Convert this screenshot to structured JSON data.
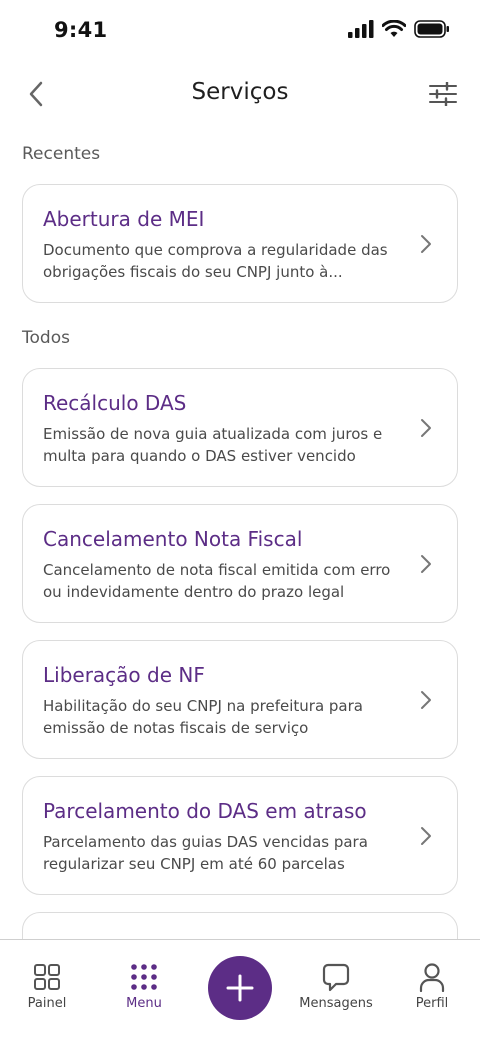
{
  "status_bar": {
    "time": "9:41"
  },
  "header": {
    "title": "Serviços"
  },
  "sections": {
    "recent": "Recentes",
    "all": "Todos"
  },
  "recent_cards": [
    {
      "title": "Abertura de MEI",
      "description": "Documento que comprova a regularidade das obrigações fiscais do seu CNPJ junto à..."
    }
  ],
  "all_cards": [
    {
      "title": "Recálculo DAS",
      "description": "Emissão de nova guia atualizada com juros e multa para quando o DAS estiver vencido"
    },
    {
      "title": "Cancelamento Nota Fiscal",
      "description": "Cancelamento de nota fiscal emitida com erro ou indevidamente dentro do prazo legal"
    },
    {
      "title": "Liberação de NF",
      "description": "Habilitação do seu CNPJ na prefeitura para emissão de notas fiscais de serviço"
    },
    {
      "title": "Parcelamento do DAS em atraso",
      "description": "Parcelamento das guias DAS vencidas para regularizar seu CNPJ em até 60 parcelas"
    }
  ],
  "bottom_nav": {
    "painel": "Painel",
    "menu": "Menu",
    "mensagens": "Mensagens",
    "perfil": "Perfil",
    "active": "menu"
  },
  "colors": {
    "accent": "#5c2d86",
    "border": "#dcdcdc"
  }
}
